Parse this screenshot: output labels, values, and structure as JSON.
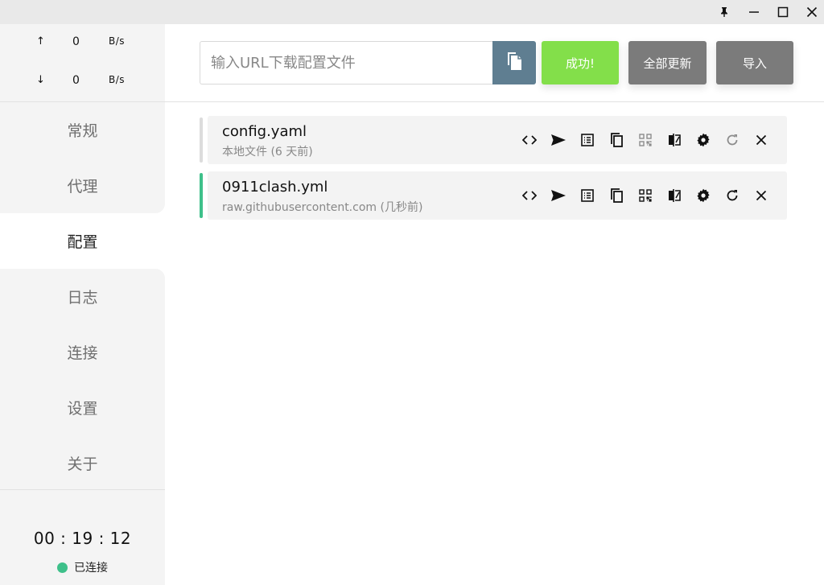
{
  "window": {
    "buttons": [
      "pin-icon",
      "minimize-icon",
      "maximize-icon",
      "close-icon"
    ]
  },
  "traffic": {
    "up": {
      "arrow": "↑",
      "value": "0",
      "unit": "B/s"
    },
    "down": {
      "arrow": "↓",
      "value": "0",
      "unit": "B/s"
    }
  },
  "nav": {
    "items": [
      {
        "label": "常规"
      },
      {
        "label": "代理"
      },
      {
        "label": "配置",
        "active": true
      },
      {
        "label": "日志"
      },
      {
        "label": "连接"
      },
      {
        "label": "设置"
      },
      {
        "label": "关于"
      }
    ]
  },
  "footer": {
    "uptime": "00 : 19 : 12",
    "status": "已连接",
    "status_color": "#3ec08a"
  },
  "header": {
    "url_placeholder": "输入URL下载配置文件",
    "url_value": "",
    "paste_icon": "paste-icon",
    "success_label": "成功!",
    "update_all_label": "全部更新",
    "import_label": "导入"
  },
  "profiles": [
    {
      "name": "config.yaml",
      "desc": "本地文件 (6 天前)",
      "selected": false
    },
    {
      "name": "0911clash.yml",
      "desc": "raw.githubusercontent.com (几秒前)",
      "selected": true
    }
  ],
  "colors": {
    "accent_green": "#3ec08a",
    "success_button": "#83df4a",
    "paste_button": "#5f7e91",
    "gray_button": "#7b7b7b"
  }
}
